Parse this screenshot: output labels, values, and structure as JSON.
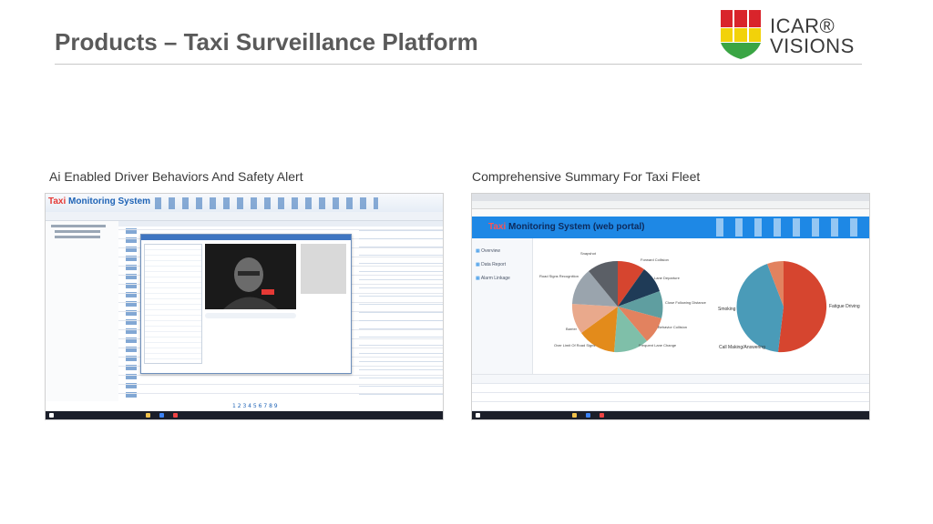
{
  "header": {
    "title": "Products – Taxi Surveillance Platform"
  },
  "logo": {
    "line1": "ICAR®",
    "line2": "VISIONS",
    "colors": {
      "red": "#d9242b",
      "yellow": "#f2d20a",
      "green": "#3aa544"
    }
  },
  "left_panel": {
    "caption": "Ai Enabled Driver Behaviors And Safety Alert",
    "app_title_prefix": "Taxi",
    "app_title_rest": " Monitoring System",
    "pagination": "1 2 3 4 5 6 7 8 9"
  },
  "right_panel": {
    "caption": "Comprehensive Summary For Taxi Fleet",
    "app_title_prefix": "Taxi",
    "app_title_rest": " Monitoring System (web portal)",
    "sidebar": [
      "Overview",
      "Data Report",
      "Alarm Linkage"
    ],
    "pie_left_labels": [
      "Snapshot",
      "Forward Collision",
      "Lane Departure",
      "Road Signs Recognition",
      "Close Following Distance",
      "Barrier",
      "Behavior Collision",
      "Over Limit Of Road Signs",
      "Frequent Lane Change"
    ],
    "pie_right_labels": [
      "Smoking",
      "Fatigue Driving",
      "Call Making/Answering"
    ],
    "colors": {
      "banner": "#1e88e5",
      "pie1": [
        "#d6452f",
        "#1f3b57",
        "#5f9ea0",
        "#e2825f",
        "#7fbfa9",
        "#e38b1b",
        "#e9a98c",
        "#9aa4ad",
        "#5b5f66"
      ],
      "pie2": [
        "#d6452f",
        "#4a9bb8",
        "#e2825f"
      ]
    }
  }
}
